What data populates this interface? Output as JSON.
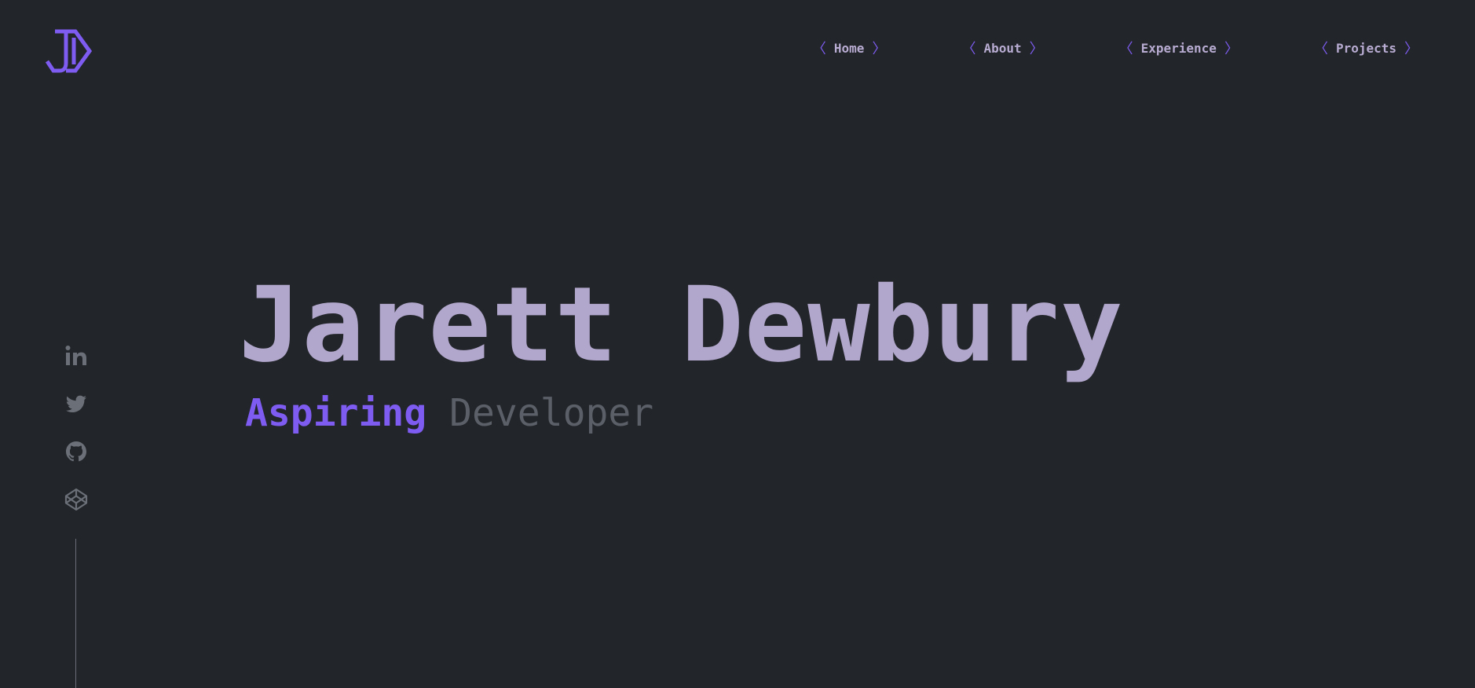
{
  "brand": {
    "logo_icon": "jd-hexagon-logo-icon",
    "accent_color": "#7e5cf2"
  },
  "nav": {
    "items": [
      {
        "label": "Home",
        "open": "〈",
        "close": "〉"
      },
      {
        "label": "About",
        "open": "〈",
        "close": "〉"
      },
      {
        "label": "Experience",
        "open": "〈",
        "close": "〉"
      },
      {
        "label": "Projects",
        "open": "〈",
        "close": "〉"
      }
    ]
  },
  "social": {
    "icons": [
      "linkedin-icon",
      "twitter-icon",
      "github-icon",
      "codepen-icon"
    ],
    "icon_color": "#6b7078"
  },
  "hero": {
    "name": "Jarett Dewbury",
    "subtitle_accent": "Aspiring",
    "subtitle_rest": "Developer",
    "name_color": "#b1a6cc",
    "muted_color": "#5b6068"
  },
  "colors": {
    "background": "#222529"
  }
}
